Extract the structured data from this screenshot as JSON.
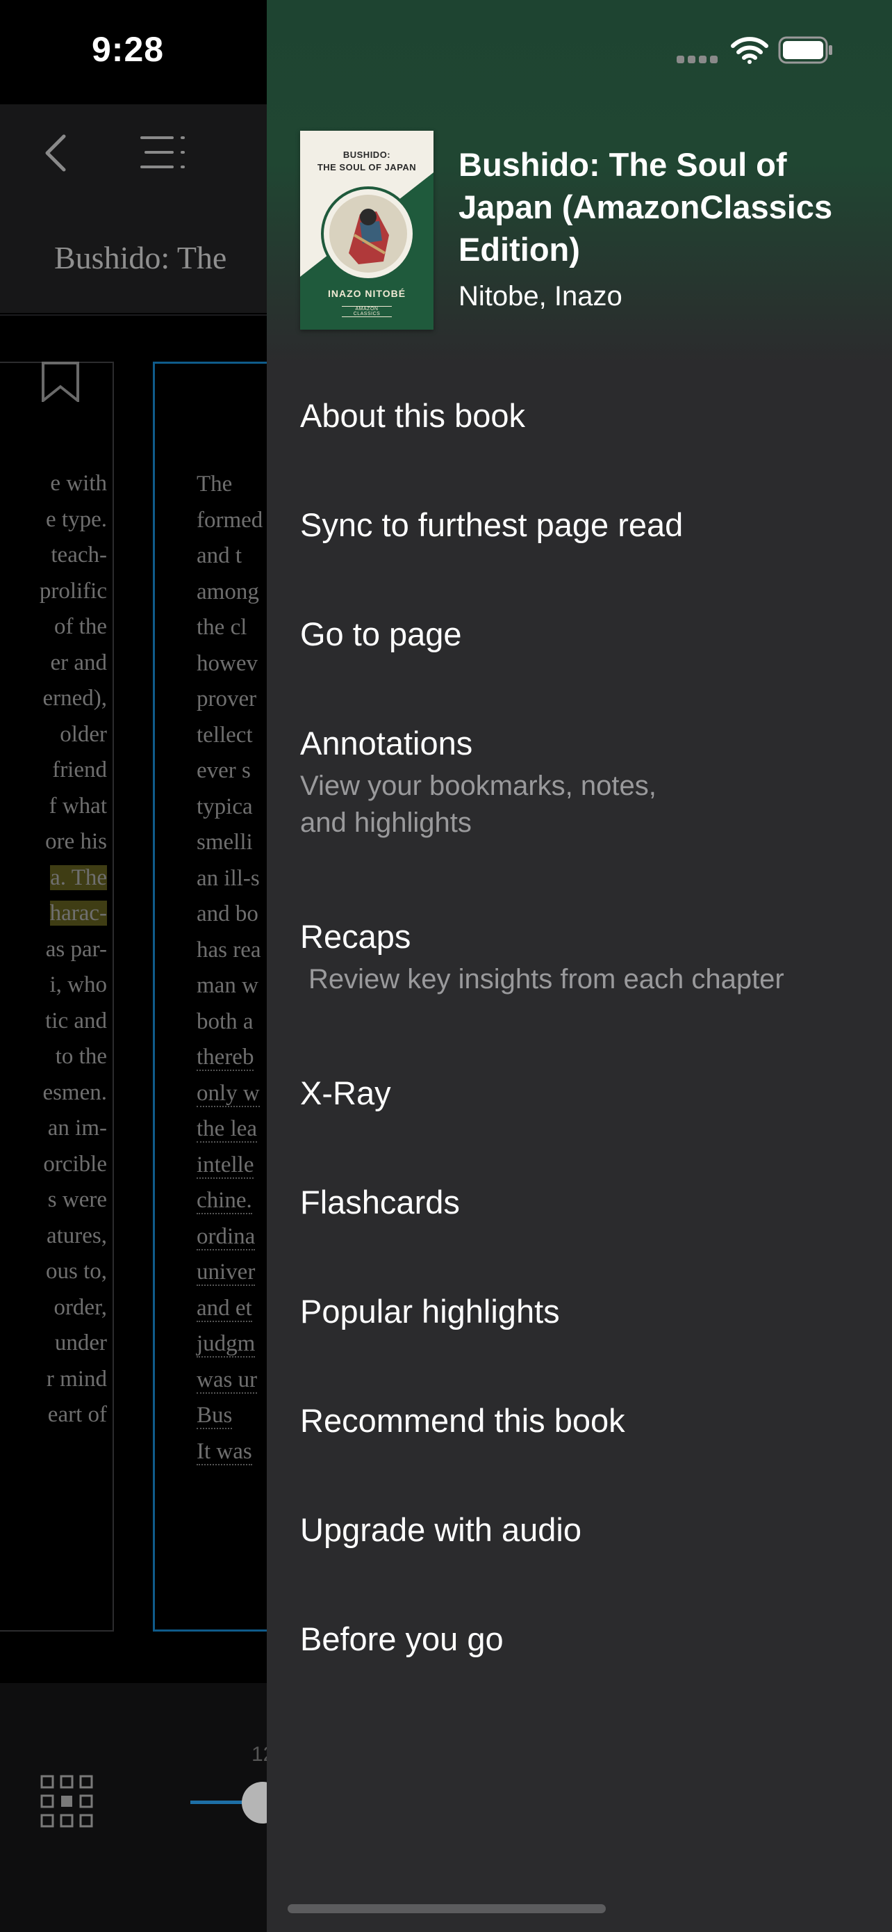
{
  "status_bar": {
    "time": "9:28"
  },
  "reader": {
    "title": "Bushido: The",
    "progress_label": "12",
    "left_page_lines": [
      "e with",
      "e type.",
      "teach-",
      "prolific",
      "of the",
      "er and",
      "erned),",
      "older",
      "friend",
      "f what",
      "ore his",
      "a. The",
      "harac-",
      "as par-",
      "i, who",
      "tic and",
      "to the",
      "esmen.",
      "an im-",
      "orcible",
      "s were",
      "atures,",
      "ous to,",
      "order,",
      "under",
      "r mind",
      "eart of"
    ],
    "right_page_lines": [
      "The",
      "formed",
      "and t",
      "among",
      "the cl",
      "howev",
      "prover",
      "tellect",
      "ever s",
      "typica",
      "smelli",
      "an ill-s",
      "and bo",
      "has rea",
      "man w",
      "both a",
      "thereb",
      "only w",
      "the lea",
      "intelle",
      "chine.",
      "ordina",
      "univer",
      "and et",
      "judgm",
      "was ur",
      "Bus",
      "It was"
    ]
  },
  "drawer": {
    "cover": {
      "title_line1": "BUSHIDO:",
      "title_line2": "THE SOUL OF JAPAN",
      "author": "INAZO NITOBÉ",
      "publisher": "AMAZON CLASSICS"
    },
    "book_title": "Bushido: The Soul of Japan (AmazonClassics Edition)",
    "book_author": "Nitobe, Inazo",
    "menu": [
      {
        "label": "About this book"
      },
      {
        "label": "Sync to furthest page read"
      },
      {
        "label": "Go to page"
      },
      {
        "label": "Annotations",
        "sub": "View your bookmarks, notes, and highlights"
      },
      {
        "label": "Recaps",
        "sub": "Review key insights from each chapter"
      },
      {
        "label": "X-Ray"
      },
      {
        "label": "Flashcards"
      },
      {
        "label": "Popular highlights"
      },
      {
        "label": "Recommend this book"
      },
      {
        "label": "Upgrade with audio"
      },
      {
        "label": "Before you go"
      }
    ]
  },
  "colors": {
    "drawer_bg": "#2b2b2d",
    "header_green": "#1e4431",
    "accent_blue": "#1d6fa6"
  }
}
